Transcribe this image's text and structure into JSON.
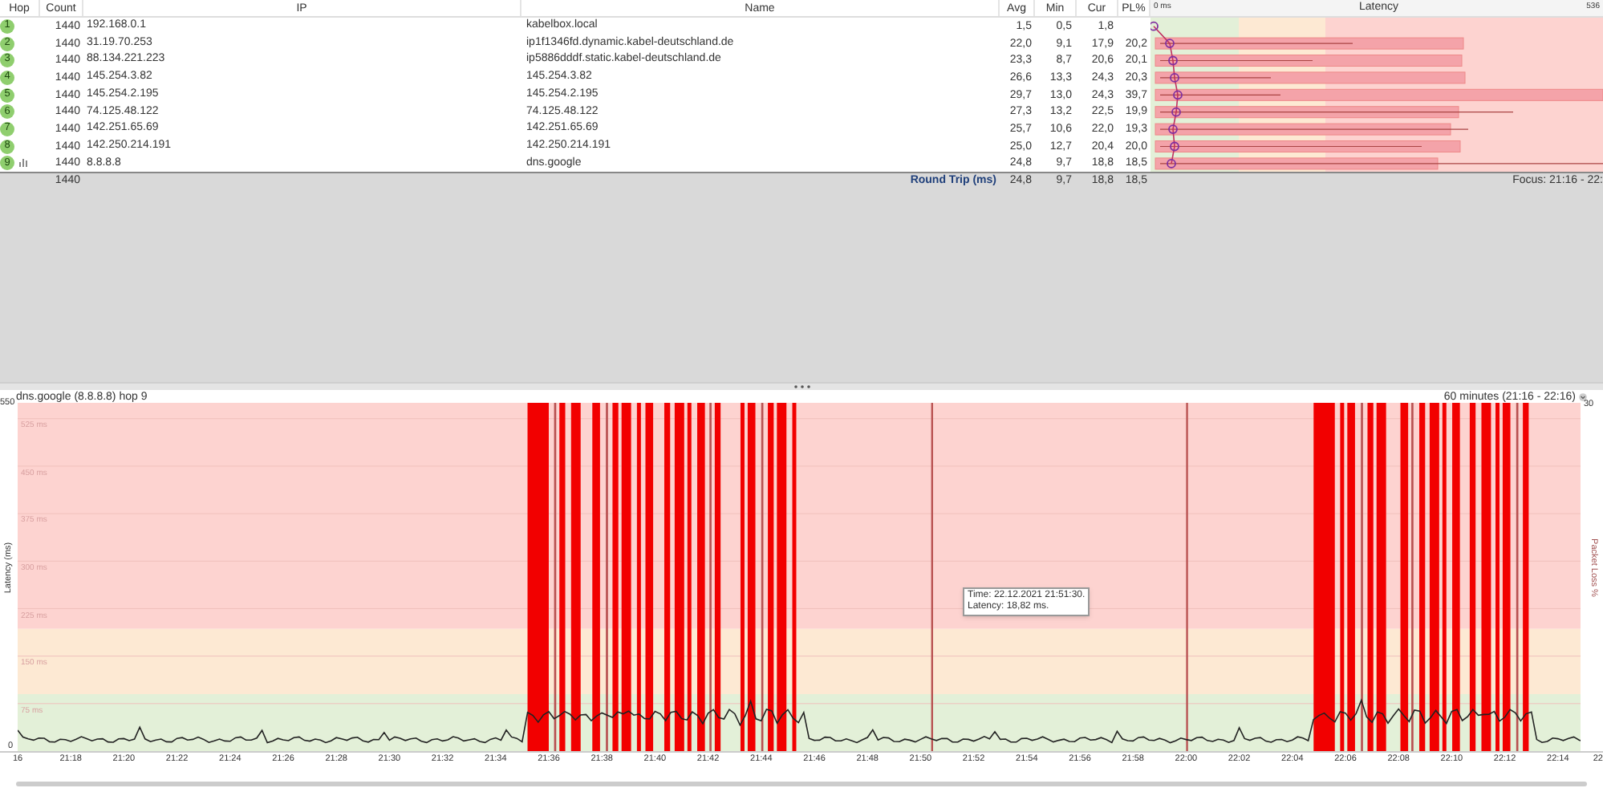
{
  "table": {
    "columns": [
      "Hop",
      "Count",
      "IP",
      "Name",
      "Avg",
      "Min",
      "Cur",
      "PL%"
    ],
    "latency_header": {
      "scale_min": "0 ms",
      "title": "Latency",
      "scale_max": "536"
    },
    "rows": [
      {
        "hop": "1",
        "graphed": false,
        "count": "1440",
        "ip": "192.168.0.1",
        "name": "kabelbox.local",
        "avg": "1,5",
        "min": "0,5",
        "cur": "1,8"
      },
      {
        "hop": "2",
        "graphed": false,
        "count": "1440",
        "ip": "31.19.70.253",
        "name": "ip1f1346fd.dynamic.kabel-deutschland.de",
        "avg": "22,0",
        "min": "9,1",
        "cur": "17,9",
        "pl": "20,2"
      },
      {
        "hop": "3",
        "graphed": false,
        "count": "1440",
        "ip": "88.134.221.223",
        "name": "ip5886dddf.static.kabel-deutschland.de",
        "avg": "23,3",
        "min": "8,7",
        "cur": "20,6",
        "pl": "20,1"
      },
      {
        "hop": "4",
        "graphed": false,
        "count": "1440",
        "ip": "145.254.3.82",
        "name": "145.254.3.82",
        "avg": "26,6",
        "min": "13,3",
        "cur": "24,3",
        "pl": "20,3"
      },
      {
        "hop": "5",
        "graphed": false,
        "count": "1440",
        "ip": "145.254.2.195",
        "name": "145.254.2.195",
        "avg": "29,7",
        "min": "13,0",
        "cur": "24,3",
        "pl": "39,7"
      },
      {
        "hop": "6",
        "graphed": false,
        "count": "1440",
        "ip": "74.125.48.122",
        "name": "74.125.48.122",
        "avg": "27,3",
        "min": "13,2",
        "cur": "22,5",
        "pl": "19,9"
      },
      {
        "hop": "7",
        "graphed": false,
        "count": "1440",
        "ip": "142.251.65.69",
        "name": "142.251.65.69",
        "avg": "25,7",
        "min": "10,6",
        "cur": "22,0",
        "pl": "19,3"
      },
      {
        "hop": "8",
        "graphed": false,
        "count": "1440",
        "ip": "142.250.214.191",
        "name": "142.250.214.191",
        "avg": "25,0",
        "min": "12,7",
        "cur": "20,4",
        "pl": "20,0"
      },
      {
        "hop": "9",
        "graphed": true,
        "count": "1440",
        "ip": "8.8.8.8",
        "name": "dns.google",
        "avg": "24,8",
        "min": "9,7",
        "cur": "18,8",
        "pl": "18,5"
      }
    ]
  },
  "summary": {
    "count": "1440",
    "label": "Round Trip (ms)",
    "avg": "24,8",
    "min": "9,7",
    "cur": "18,8",
    "pl": "18,5",
    "focus": "Focus: 21:16 - 22:"
  },
  "chart": {
    "title": "dns.google (8.8.8.8) hop 9",
    "range": "60 minutes (21:16 - 22:16)",
    "y_max": "550",
    "y_min": "0",
    "y_right_max": "30",
    "ylabel": "Latency (ms)",
    "y2label": "Packet Loss %",
    "band_labels": [
      "525 ms",
      "450 ms",
      "375 ms",
      "300 ms",
      "225 ms",
      "150 ms",
      "75 ms"
    ],
    "xticks": [
      "16",
      "21:18",
      "21:20",
      "21:22",
      "21:24",
      "21:26",
      "21:28",
      "21:30",
      "21:32",
      "21:34",
      "21:36",
      "21:38",
      "21:40",
      "21:42",
      "21:44",
      "21:46",
      "21:48",
      "21:50",
      "21:52",
      "21:54",
      "21:56",
      "21:58",
      "22:00",
      "22:02",
      "22:04",
      "22:06",
      "22:08",
      "22:10",
      "22:12",
      "22:14",
      "22"
    ],
    "tooltip": {
      "time": "Time: 22.12.2021 21:51:30.",
      "latency": "Latency: 18,82 ms."
    }
  }
}
